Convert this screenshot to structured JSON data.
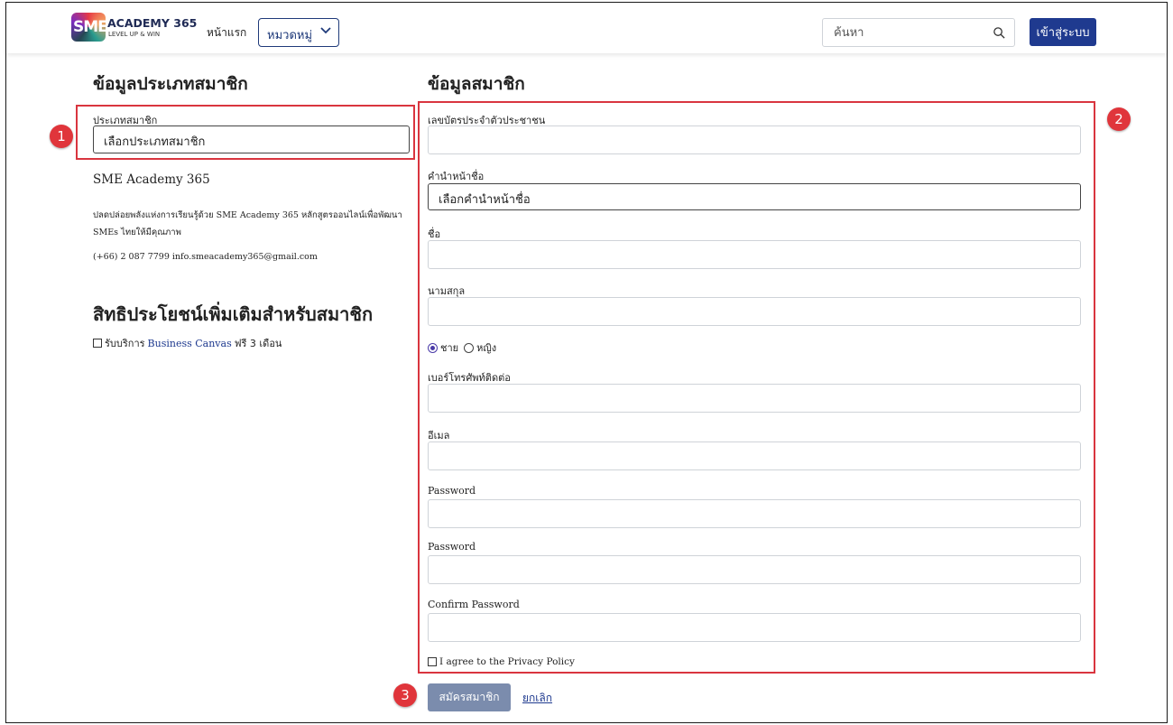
{
  "header": {
    "logo_mark": "SME",
    "logo_title": "ACADEMY 365",
    "logo_tagline": "LEVEL UP & WIN",
    "nav_home": "หน้าแรก",
    "category_label": "หมวดหมู่",
    "search_placeholder": "ค้นหา",
    "login_label": "เข้าสู่ระบบ"
  },
  "left": {
    "heading": "ข้อมูลประเภทสมาชิก",
    "member_type_label": "ประเภทสมาชิก",
    "member_type_value": "เลือกประเภทสมาชิก",
    "org_name": "SME Academy 365",
    "org_desc": "ปลดปล่อยพลังแห่งการเรียนรู้ด้วย SME Academy 365 หลักสูตรออนไลน์เพื่อพัฒนา SMEs ไทยให้มีคุณภาพ",
    "contact": "(+66) 2 087 7799 info.smeacademy365@gmail.com",
    "benefits_heading": "สิทธิประโยชน์เพิ่มเติมสำหรับสมาชิก",
    "benefit_prefix": "รับบริการ",
    "benefit_link": "Business Canvas",
    "benefit_suffix": "ฟรี 3 เดือน"
  },
  "right": {
    "heading": "ข้อมูลสมาชิก",
    "id_card_label": "เลขบัตรประจำตัวประชาชน",
    "title_label": "คำนำหน้าชื่อ",
    "title_value": "เลือกคำนำหน้าชื่อ",
    "first_name_label": "ชื่อ",
    "last_name_label": "นามสกุล",
    "gender_male": "ชาย",
    "gender_female": "หญิง",
    "phone_label": "เบอร์โทรศัพท์ติดต่อ",
    "email_label": "อีเมล",
    "password_label_1": "Password",
    "password_label_2": "Password",
    "confirm_password_label": "Confirm Password",
    "agree_label": "I agree to the Privacy Policy",
    "submit_label": "สมัครสมาชิก",
    "cancel_label": "ยกเลิก"
  },
  "annotations": [
    "1",
    "2",
    "3"
  ],
  "colors": {
    "primary": "#1f3a8f",
    "submit_disabled": "#7b8cad",
    "highlight": "#d9353f"
  }
}
